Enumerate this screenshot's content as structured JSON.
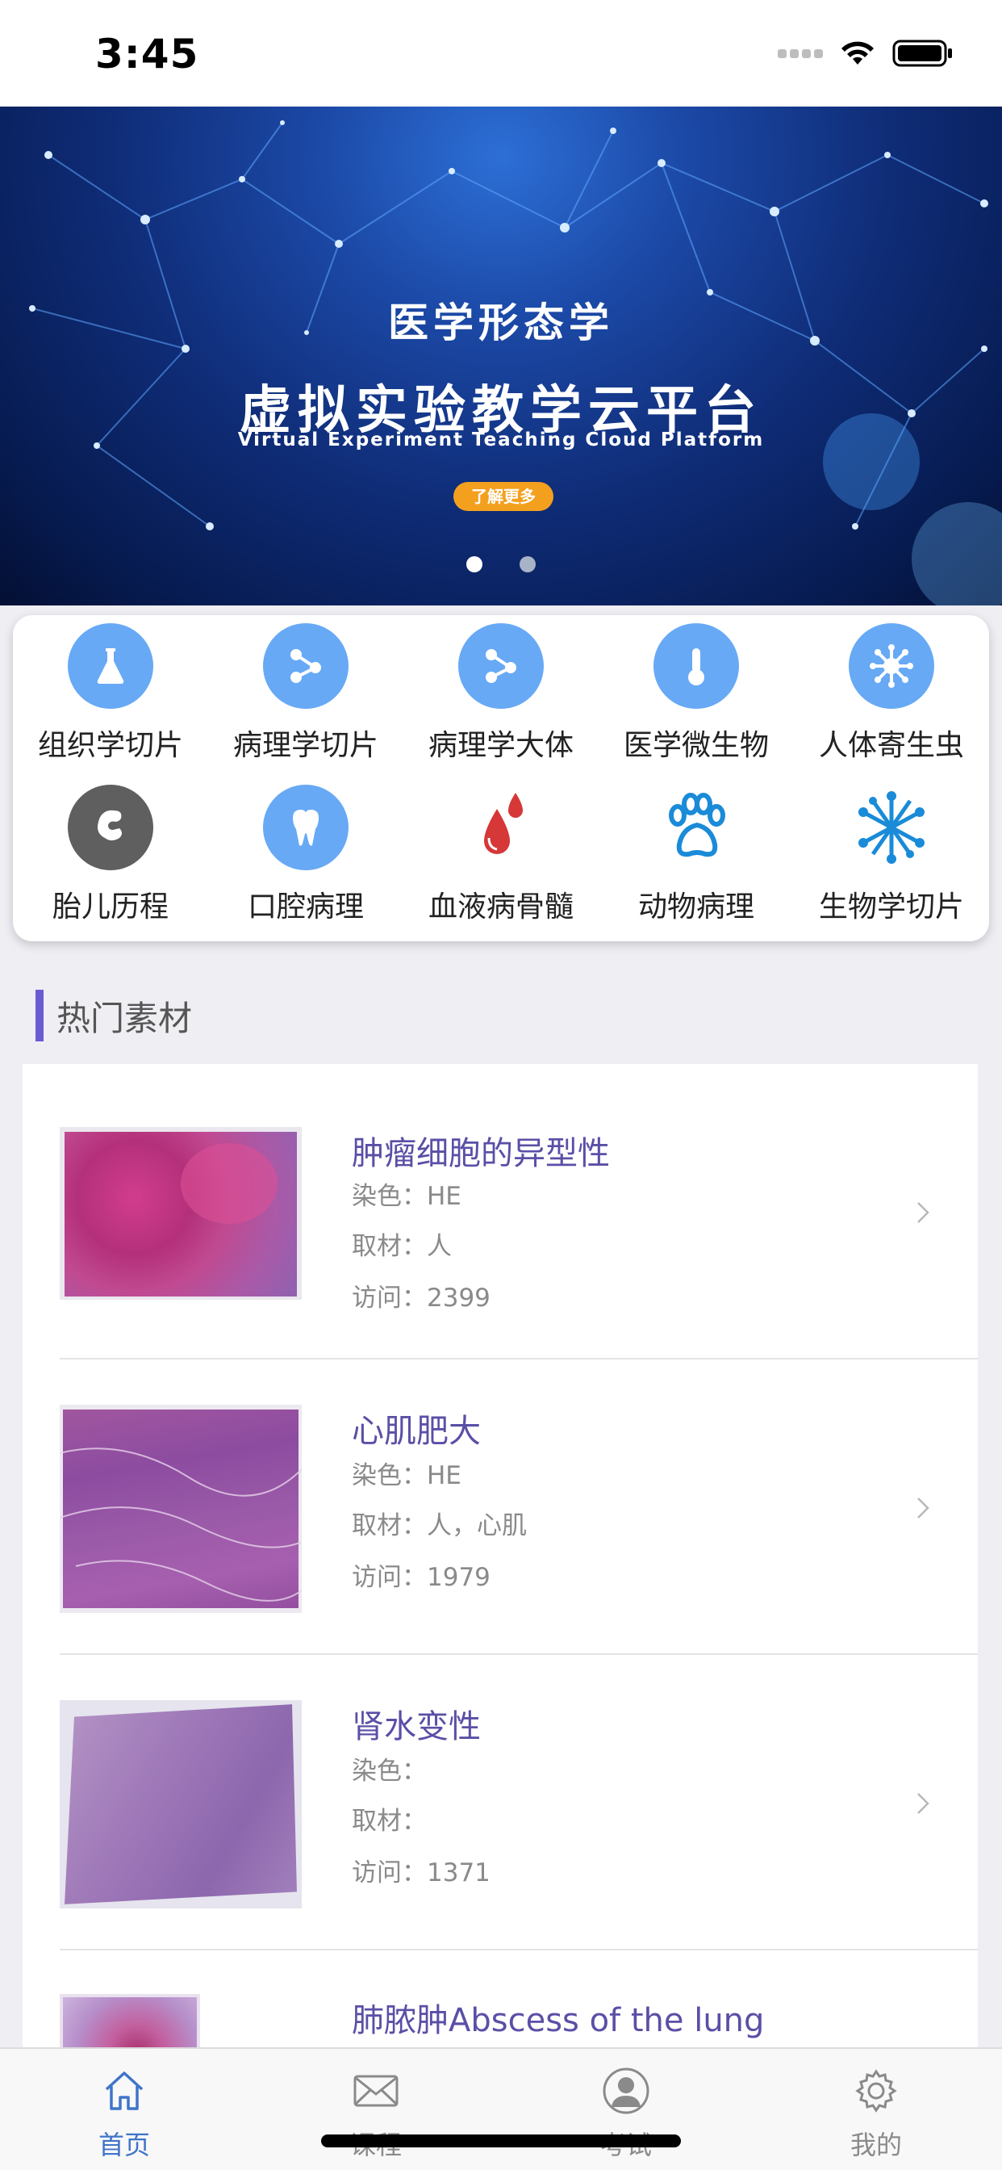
{
  "status_bar": {
    "time": "3:45"
  },
  "banner": {
    "subtitle": "医学形态学",
    "title": "虚拟实验教学云平台",
    "english": "Virtual Experiment Teaching Cloud Platform",
    "button": "了解更多",
    "dots": 2,
    "active_dot": 0
  },
  "categories": [
    {
      "label": "组织学切片",
      "icon": "flask-icon"
    },
    {
      "label": "病理学切片",
      "icon": "share-nodes-icon"
    },
    {
      "label": "病理学大体",
      "icon": "share-nodes-icon"
    },
    {
      "label": "医学微生物",
      "icon": "thermometer-icon"
    },
    {
      "label": "人体寄生虫",
      "icon": "virus-icon"
    },
    {
      "label": "胎儿历程",
      "icon": "fetus-icon"
    },
    {
      "label": "口腔病理",
      "icon": "tooth-icon"
    },
    {
      "label": "血液病骨髓",
      "icon": "blood-drops-icon"
    },
    {
      "label": "动物病理",
      "icon": "paw-icon"
    },
    {
      "label": "生物学切片",
      "icon": "molecule-icon"
    }
  ],
  "section": {
    "title": "热门素材"
  },
  "materials": [
    {
      "title": "肿瘤细胞的异型性",
      "stain": "染色：HE",
      "source": "取材：人",
      "visits": "访问：2399"
    },
    {
      "title": "心肌肥大",
      "stain": "染色：HE",
      "source": "取材：人，心肌",
      "visits": "访问：1979"
    },
    {
      "title": "肾水变性",
      "stain": "染色：",
      "source": "取材：",
      "visits": "访问：1371"
    },
    {
      "title": "肺脓肿Abscess of the lung",
      "stain": "",
      "source": "",
      "visits": ""
    }
  ],
  "tab_bar": {
    "tabs": [
      {
        "label": "首页",
        "icon": "home-icon",
        "active": true
      },
      {
        "label": "课程",
        "icon": "mail-icon",
        "active": false
      },
      {
        "label": "考试",
        "icon": "user-icon",
        "active": false
      },
      {
        "label": "我的",
        "icon": "gear-icon",
        "active": false
      }
    ]
  },
  "colors": {
    "accent": "#6b5bd2",
    "icon_blue": "#67a9f5",
    "title_purple": "#5a4fa6",
    "tab_active": "#3f74c9",
    "tab_inactive": "#8a8a8a",
    "banner_button": "#f3a01f"
  }
}
